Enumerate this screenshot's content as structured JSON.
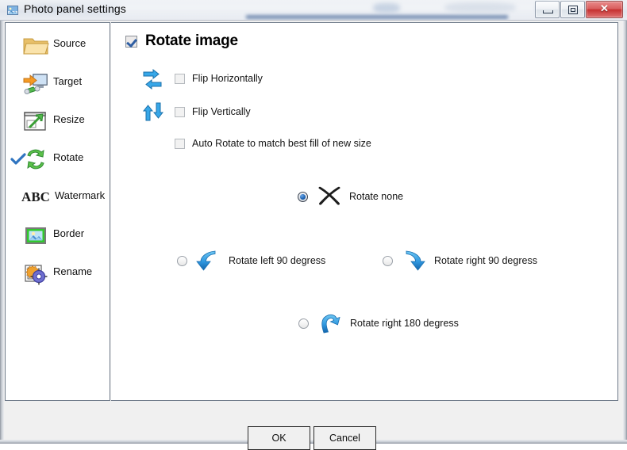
{
  "window": {
    "title": "Photo panel settings",
    "app_icon": "photo-icon",
    "controls": {
      "minimize": "minimize-button",
      "maximize": "maximize-button",
      "close_label": "✕"
    }
  },
  "sidebar": {
    "items": [
      {
        "label": "Source",
        "icon": "folder-icon",
        "selected": false
      },
      {
        "label": "Target",
        "icon": "monitor-arrow-icon",
        "selected": false
      },
      {
        "label": "Resize",
        "icon": "resize-arrow-icon",
        "selected": false
      },
      {
        "label": "Rotate",
        "icon": "rotate-arrows-icon",
        "selected": true
      },
      {
        "label": "Watermark",
        "icon": "abc-text-icon",
        "selected": false
      },
      {
        "label": "Border",
        "icon": "picture-border-icon",
        "selected": false
      },
      {
        "label": "Rename",
        "icon": "gear-squares-icon",
        "selected": false
      }
    ]
  },
  "main": {
    "header": {
      "label": "Rotate image",
      "checked": true
    },
    "checkboxes": [
      {
        "label": "Flip Horizontally",
        "icon": "flip-horizontal-icon",
        "checked": false
      },
      {
        "label": "Flip Vertically",
        "icon": "flip-vertical-icon",
        "checked": false
      },
      {
        "label": "Auto Rotate to match best fill of new size",
        "icon": "",
        "checked": false
      }
    ],
    "radios": [
      {
        "label": "Rotate none",
        "icon": "x-mark-icon",
        "selected": true
      },
      {
        "label": "Rotate left 90 degress",
        "icon": "rotate-left-arrow-icon",
        "selected": false
      },
      {
        "label": "Rotate right 90 degress",
        "icon": "rotate-right-arrow-icon",
        "selected": false
      },
      {
        "label": "Rotate right 180 degress",
        "icon": "rotate-180-arrow-icon",
        "selected": false
      }
    ]
  },
  "footer": {
    "ok_label": "OK",
    "cancel_label": "Cancel"
  },
  "colors": {
    "accent_blue": "#2f86d8",
    "icon_green": "#5cc14a",
    "close_red": "#c53131",
    "panel_bg": "#ffffff",
    "window_bg": "#f0f0f0"
  }
}
